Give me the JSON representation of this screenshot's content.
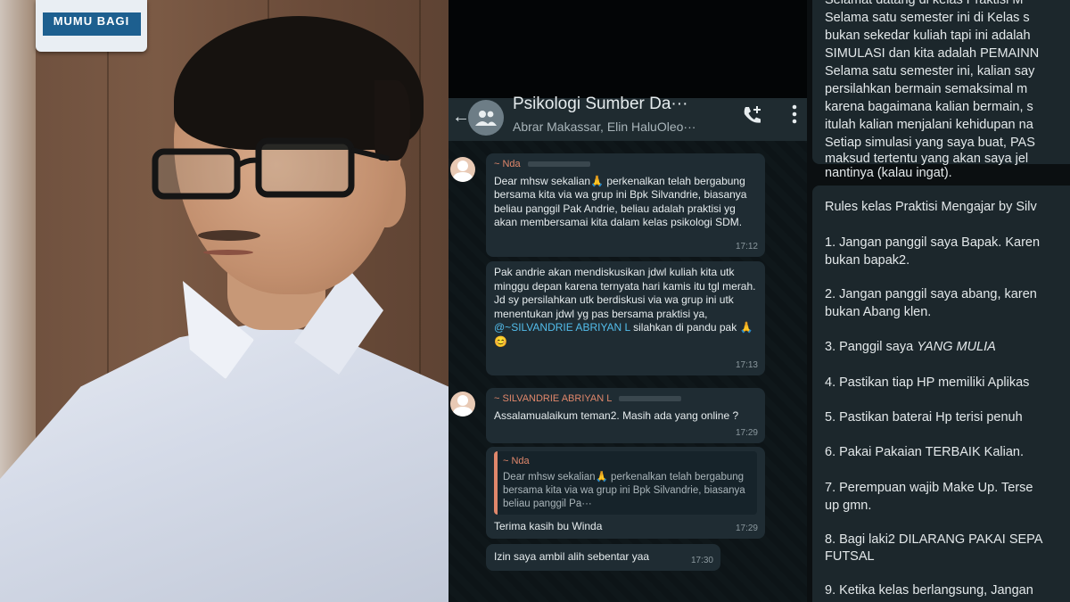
{
  "photo": {
    "sign_text": "MUMU BAGI"
  },
  "chat": {
    "header": {
      "back_icon": "arrow-left-icon",
      "title": "Psikologi Sumber Da···",
      "subtitle": "Abrar Makassar, Elin HaluOleo···",
      "call_icon": "add-call-icon",
      "more_icon": "more-vert-icon"
    },
    "messages": [
      {
        "sender": "~ Nda",
        "text": "Dear mhsw sekalian🙏 perkenalkan telah bergabung bersama kita via wa grup ini Bpk Silvandrie, biasanya beliau panggil Pak Andrie, beliau adalah praktisi yg akan membersamai kita dalam kelas psikologi SDM.",
        "time": "17:12"
      },
      {
        "text_before": "Pak andrie akan mendiskusikan jdwl kuliah kita utk minggu depan karena ternyata hari kamis itu tgl merah. Jd sy persilahkan utk berdiskusi via wa grup ini utk menentukan jdwl yg pas bersama praktisi ya, ",
        "mention": "@~SILVANDRIE ABRIYAN L",
        "text_after": " silahkan di pandu pak 🙏😊",
        "time": "17:13"
      },
      {
        "sender": "~ SILVANDRIE ABRIYAN L",
        "text": "Assalamualaikum teman2. Masih ada yang online ?",
        "time": "17:29"
      },
      {
        "quote_sender": "~ Nda",
        "quote_text": "Dear mhsw sekalian🙏 perkenalkan telah bergabung bersama kita via wa grup ini Bpk Silvandrie, biasanya beliau panggil Pa···",
        "text": "Terima kasih bu Winda",
        "time": "17:29"
      },
      {
        "text": "Izin saya ambil alih sebentar yaa",
        "time": "17:30"
      }
    ]
  },
  "rules": {
    "intro_lines": [
      "Selamat datang di kelas Praktisi M",
      "Selama satu semester ini di Kelas s",
      "bukan sekedar kuliah tapi ini adalah",
      "SIMULASI dan kita adalah PEMAINN",
      "Selama satu semester ini, kalian say",
      "persilahkan bermain semaksimal m",
      "karena bagaimana kalian bermain, s",
      "itulah kalian menjalani kehidupan na",
      "Setiap simulasi yang saya buat, PAS",
      "maksud tertentu yang akan saya jel",
      "nantinya (kalau ingat)."
    ],
    "heading": "Rules kelas Praktisi Mengajar by Silv",
    "items": [
      "1. Jangan panggil saya Bapak. Karen",
      "bukan bapak2.",
      "2. Jangan panggil saya abang, karen",
      "bukan Abang klen.",
      "3. Panggil saya ",
      "YANG MULIA",
      "4. Pastikan tiap HP memiliki Aplikas",
      "5. Pastikan baterai Hp terisi penuh",
      "6. Pakai Pakaian TERBAIK Kalian.",
      "7. Perempuan wajib Make Up. Terse",
      "up gmn.",
      "8. Bagi laki2 DILARANG PAKAI SEPA",
      "FUTSAL",
      "9. Ketika kelas berlangsung, Jangan"
    ]
  }
}
